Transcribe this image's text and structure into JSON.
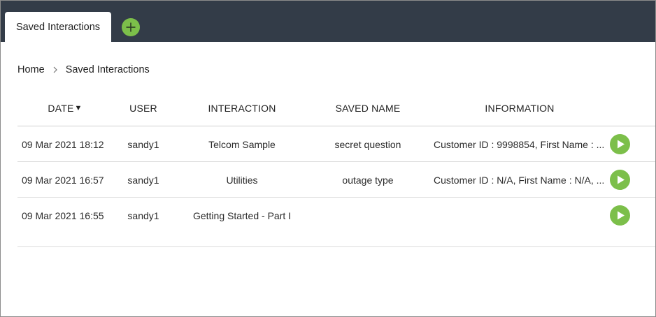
{
  "tabs": [
    {
      "label": "Saved Interactions"
    }
  ],
  "breadcrumb": {
    "home": "Home",
    "current": "Saved Interactions"
  },
  "table": {
    "headers": {
      "date": "DATE",
      "sort_arrow": "▼",
      "user": "USER",
      "interaction": "INTERACTION",
      "saved_name": "SAVED NAME",
      "information": "INFORMATION"
    },
    "rows": [
      {
        "date": "09 Mar 2021 18:12",
        "user": "sandy1",
        "interaction": "Telcom Sample",
        "saved_name": "secret question",
        "information": "Customer ID : 9998854, First Name : ..."
      },
      {
        "date": "09 Mar 2021 16:57",
        "user": "sandy1",
        "interaction": "Utilities",
        "saved_name": "outage type",
        "information": "Customer ID : N/A, First Name : N/A, ..."
      },
      {
        "date": "09 Mar 2021 16:55",
        "user": "sandy1",
        "interaction": "Getting Started - Part I",
        "saved_name": "",
        "information": ""
      }
    ]
  },
  "icons": {
    "add": "plus-icon",
    "play": "play-icon",
    "separator": "chevron-right-icon"
  },
  "colors": {
    "topbar": "#333c48",
    "accent_green": "#7cbf4a"
  }
}
